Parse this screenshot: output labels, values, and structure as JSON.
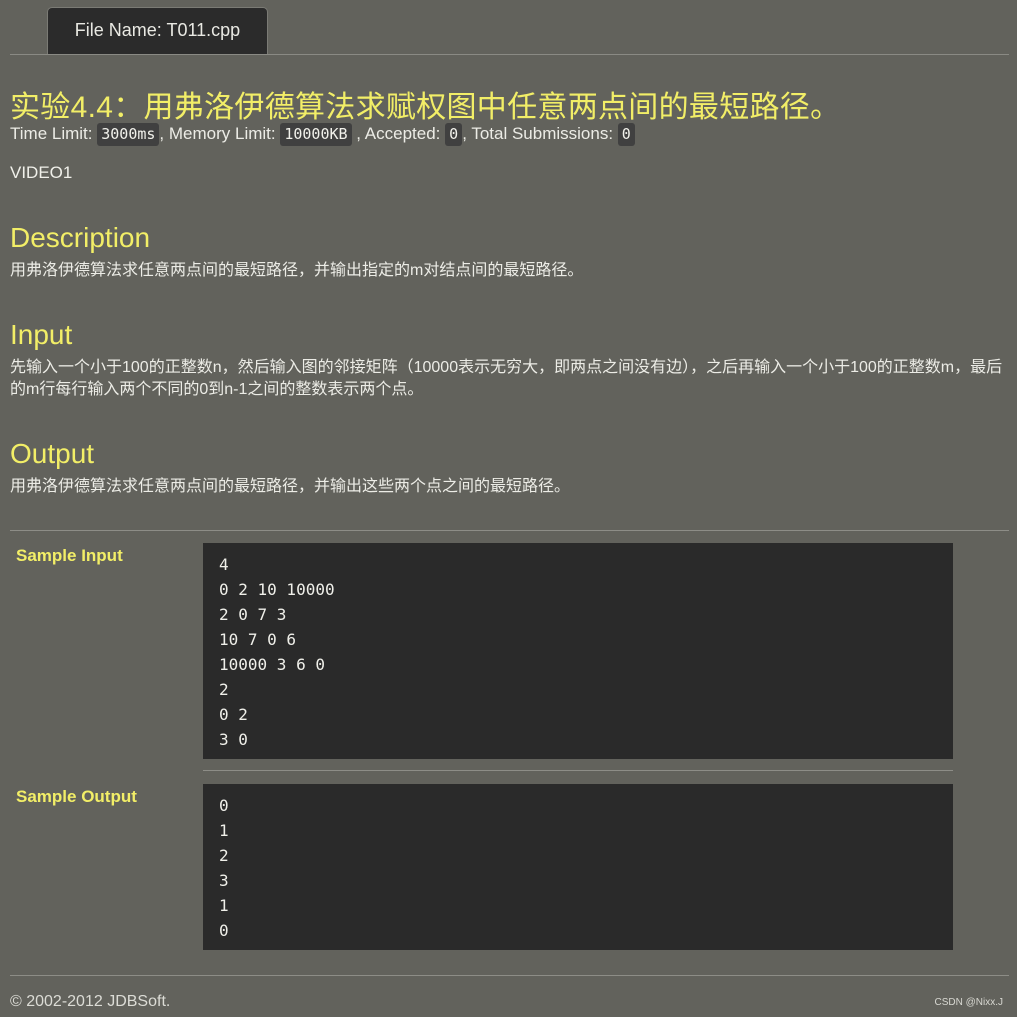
{
  "tab": {
    "file_name_label": "File Name: T011.cpp"
  },
  "problem": {
    "title": "实验4.4：用弗洛伊德算法求赋权图中任意两点间的最短路径。",
    "meta": {
      "time_limit_label": "Time Limit:",
      "time_limit_value": "3000ms",
      "memory_limit_label": ", Memory Limit:",
      "memory_limit_value": "10000KB",
      "accepted_label": ", Accepted:",
      "accepted_value": "0",
      "total_submissions_label": ", Total Submissions:",
      "total_submissions_value": "0"
    },
    "video_label": "VIDEO1"
  },
  "description": {
    "heading": "Description",
    "text": "用弗洛伊德算法求任意两点间的最短路径，并输出指定的m对结点间的最短路径。"
  },
  "input": {
    "heading": "Input",
    "text": "先输入一个小于100的正整数n，然后输入图的邻接矩阵（10000表示无穷大，即两点之间没有边），之后再输入一个小于100的正整数m，最后的m行每行输入两个不同的0到n-1之间的整数表示两个点。"
  },
  "output": {
    "heading": "Output",
    "text": "用弗洛伊德算法求任意两点间的最短路径，并输出这些两个点之间的最短路径。"
  },
  "samples": {
    "input_label": "Sample Input",
    "input_text": "4\n0 2 10 10000\n2 0 7 3\n10 7 0 6\n10000 3 6 0\n2\n0 2\n3 0",
    "output_label": "Sample Output",
    "output_text": "0\n1\n2\n3\n1\n0"
  },
  "footer": {
    "copyright": "© 2002-2012  JDBSoft.",
    "watermark": "CSDN @Nixx.J"
  }
}
